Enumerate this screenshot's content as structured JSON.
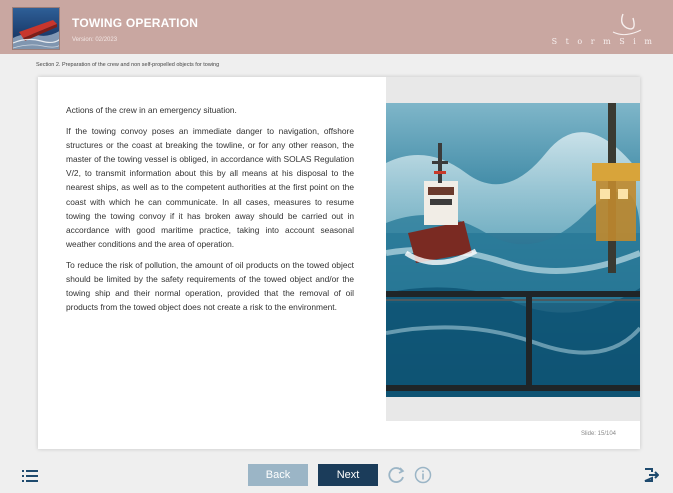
{
  "header": {
    "title": "TOWING OPERATION",
    "version": "Version: 02/2023",
    "brand": "S t o r m S i m"
  },
  "section_label": "Section 2. Preparation of the crew and non self-propelled objects for towing",
  "content": {
    "heading": "Actions of the crew in an emergency situation.",
    "paragraph1": "If the towing convoy poses an immediate danger to navigation, offshore structures or the coast at breaking the towline, or for any other reason, the master of the towing vessel is obliged, in accordance with SOLAS Regulation V/2, to transmit information about this by all means at his disposal to the nearest ships, as well as to the competent authorities at the first point on the coast with which he can communicate. In all cases, measures to resume towing the towing convoy if it has broken away should be carried out in accordance with good maritime practice, taking into account seasonal weather conditions and the area of operation.",
    "paragraph2": "To reduce the risk of pollution, the amount of oil products on the towed object should be limited by the safety requirements of the towed object and/or the towing ship and their normal operation, provided that the removal of oil products from the towed object does not create a risk to the environment."
  },
  "slide_info": "Slide: 15/104",
  "nav": {
    "back_label": "Back",
    "next_label": "Next",
    "menu_icon": "menu-list-icon",
    "reload_icon": "reload-icon",
    "info_icon": "info-icon",
    "exit_icon": "exit-icon"
  },
  "colors": {
    "header_bg": "#c9a7a1",
    "back_button": "#9bb5c6",
    "next_button": "#1b3c5a",
    "page_bg": "#efefef"
  }
}
